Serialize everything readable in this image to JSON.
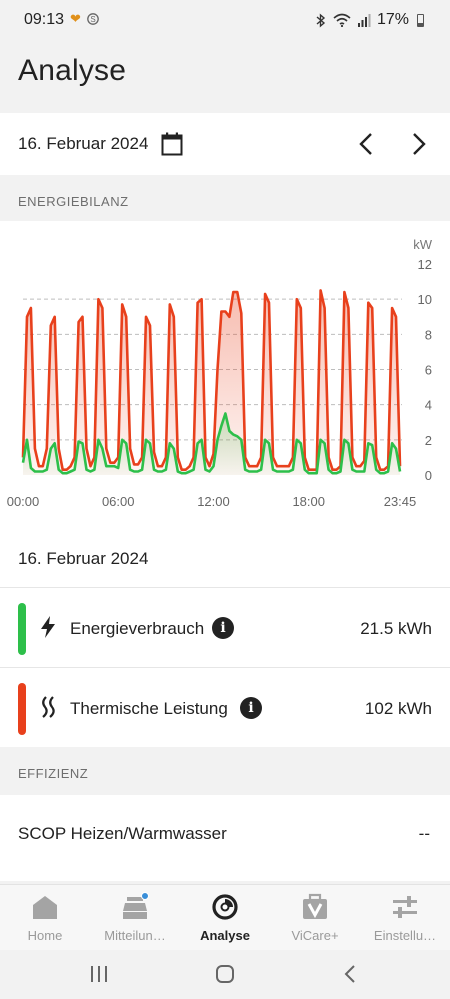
{
  "status_bar": {
    "time": "09:13",
    "battery": "17%"
  },
  "header": {
    "title": "Analyse"
  },
  "date_nav": {
    "date": "16. Februar 2024"
  },
  "sections": {
    "energy": "ENERGIEBILANZ",
    "efficiency": "EFFIZIENZ"
  },
  "summary": {
    "date": "16. Februar 2024",
    "items": [
      {
        "label": "Energieverbrauch",
        "value": "21.5 kWh",
        "color": "#2dbf4a",
        "icon": "lightning-icon"
      },
      {
        "label": "Thermische Leistung",
        "value": "102 kWh",
        "color": "#e8401c",
        "icon": "heat-waves-icon"
      }
    ]
  },
  "efficiency": {
    "label": "SCOP Heizen/Warmwasser",
    "value": "--"
  },
  "bottom_nav": [
    {
      "label": "Home",
      "icon": "house-icon",
      "active": false
    },
    {
      "label": "Mitteilun…",
      "icon": "messages-icon",
      "active": false
    },
    {
      "label": "Analyse",
      "icon": "analysis-icon",
      "active": true
    },
    {
      "label": "ViCare+",
      "icon": "vicare-plus-icon",
      "active": false
    },
    {
      "label": "Einstellu…",
      "icon": "settings-sliders-icon",
      "active": false
    }
  ],
  "chart_data": {
    "type": "line",
    "unit": "kW",
    "ylim": [
      0,
      12
    ],
    "yticks": [
      0,
      2,
      4,
      6,
      8,
      10,
      12
    ],
    "xticks": [
      "00:00",
      "06:00",
      "12:00",
      "18:00",
      "23:45"
    ],
    "grid": true,
    "colors": {
      "thermal": "#e8401c",
      "consumption": "#2dbf4a"
    },
    "series": [
      {
        "name": "Thermische Leistung",
        "x": [
          0.0,
          0.25,
          0.5,
          0.75,
          1.0,
          1.25,
          1.5,
          1.75,
          2.0,
          2.25,
          2.5,
          2.75,
          3.0,
          3.25,
          3.5,
          3.75,
          4.0,
          4.25,
          4.5,
          4.75,
          5.0,
          5.25,
          5.5,
          5.75,
          6.0,
          6.25,
          6.5,
          6.75,
          7.0,
          7.25,
          7.5,
          7.75,
          8.0,
          8.25,
          8.5,
          8.75,
          9.0,
          9.25,
          9.5,
          9.75,
          10.0,
          10.25,
          10.5,
          10.75,
          11.0,
          11.25,
          11.5,
          11.75,
          12.0,
          12.25,
          12.5,
          12.75,
          13.0,
          13.25,
          13.5,
          13.75,
          14.0,
          14.25,
          14.5,
          14.75,
          15.0,
          15.25,
          15.5,
          15.75,
          16.0,
          16.25,
          16.5,
          16.75,
          17.0,
          17.25,
          17.5,
          17.75,
          18.0,
          18.25,
          18.5,
          18.75,
          19.0,
          19.25,
          19.5,
          19.75,
          20.0,
          20.25,
          20.5,
          20.75,
          21.0,
          21.25,
          21.5,
          21.75,
          22.0,
          22.25,
          22.5,
          22.75,
          23.0,
          23.25,
          23.5,
          23.75
        ],
        "values": [
          1.0,
          9.0,
          9.5,
          1.5,
          0.5,
          0.5,
          1.5,
          8.5,
          9.0,
          1.5,
          0.3,
          0.3,
          0.5,
          1.0,
          8.7,
          9.0,
          1.5,
          0.5,
          1.0,
          10.0,
          9.5,
          1.5,
          0.7,
          0.7,
          1.0,
          9.7,
          9.0,
          1.5,
          0.6,
          0.6,
          1.0,
          9.0,
          8.5,
          1.3,
          0.5,
          0.5,
          1.0,
          9.7,
          9.0,
          1.0,
          0.3,
          0.3,
          0.5,
          1.0,
          9.8,
          10.0,
          1.0,
          0.5,
          1.2,
          6.0,
          9.3,
          9.3,
          9.0,
          10.4,
          10.4,
          9.2,
          1.0,
          0.5,
          0.5,
          0.5,
          1.0,
          10.3,
          9.8,
          1.0,
          0.5,
          0.5,
          0.5,
          0.5,
          1.0,
          10.0,
          9.5,
          1.0,
          0.3,
          0.3,
          0.3,
          10.5,
          9.5,
          1.0,
          0.3,
          0.3,
          0.5,
          10.4,
          9.5,
          1.0,
          0.5,
          0.5,
          0.8,
          9.8,
          9.5,
          1.0,
          0.3,
          0.3,
          0.5,
          9.5,
          9.0,
          0.5
        ]
      },
      {
        "name": "Energieverbrauch",
        "x": [
          0.0,
          0.25,
          0.5,
          0.75,
          1.0,
          1.25,
          1.5,
          1.75,
          2.0,
          2.25,
          2.5,
          2.75,
          3.0,
          3.25,
          3.5,
          3.75,
          4.0,
          4.25,
          4.5,
          4.75,
          5.0,
          5.25,
          5.5,
          5.75,
          6.0,
          6.25,
          6.5,
          6.75,
          7.0,
          7.25,
          7.5,
          7.75,
          8.0,
          8.25,
          8.5,
          8.75,
          9.0,
          9.25,
          9.5,
          9.75,
          10.0,
          10.25,
          10.5,
          10.75,
          11.0,
          11.25,
          11.5,
          11.75,
          12.0,
          12.25,
          12.5,
          12.75,
          13.0,
          13.25,
          13.5,
          13.75,
          14.0,
          14.25,
          14.5,
          14.75,
          15.0,
          15.25,
          15.5,
          15.75,
          16.0,
          16.25,
          16.5,
          16.75,
          17.0,
          17.25,
          17.5,
          17.75,
          18.0,
          18.25,
          18.5,
          18.75,
          19.0,
          19.25,
          19.5,
          19.75,
          20.0,
          20.25,
          20.5,
          20.75,
          21.0,
          21.25,
          21.5,
          21.75,
          22.0,
          22.25,
          22.5,
          22.75,
          23.0,
          23.25,
          23.5,
          23.75
        ],
        "values": [
          0.7,
          2.0,
          0.4,
          0.2,
          0.2,
          0.2,
          0.3,
          1.5,
          1.8,
          0.3,
          0.1,
          0.1,
          0.2,
          0.3,
          1.9,
          1.8,
          0.3,
          0.2,
          0.3,
          2.0,
          1.5,
          0.5,
          0.5,
          0.5,
          0.4,
          2.0,
          1.8,
          0.3,
          0.2,
          0.2,
          0.3,
          2.0,
          1.8,
          0.3,
          0.2,
          0.2,
          0.3,
          1.8,
          1.5,
          0.2,
          0.1,
          0.1,
          0.2,
          0.3,
          1.8,
          2.0,
          0.3,
          0.2,
          0.5,
          2.0,
          2.8,
          3.5,
          2.5,
          2.3,
          2.2,
          2.0,
          0.3,
          0.2,
          0.2,
          0.2,
          0.3,
          2.0,
          1.8,
          0.3,
          0.2,
          0.2,
          0.2,
          0.2,
          0.3,
          2.0,
          1.8,
          0.3,
          0.1,
          0.1,
          0.1,
          2.0,
          1.8,
          0.3,
          0.1,
          0.1,
          0.2,
          2.0,
          1.8,
          0.3,
          0.2,
          0.2,
          0.2,
          1.8,
          1.7,
          0.3,
          0.1,
          0.1,
          0.2,
          1.8,
          1.5,
          0.2
        ]
      }
    ]
  }
}
